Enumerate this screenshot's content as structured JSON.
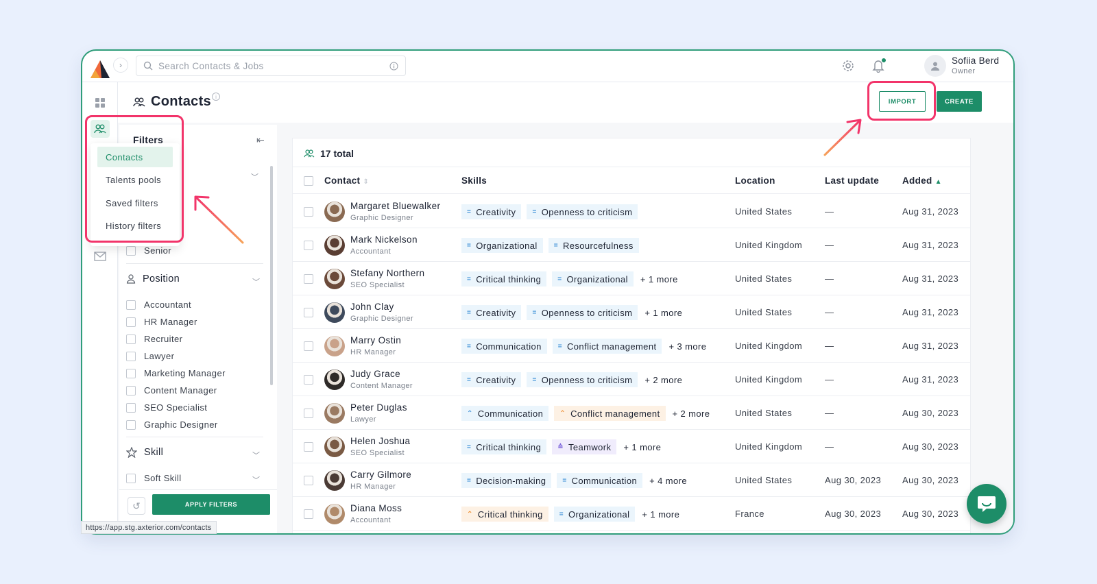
{
  "search": {
    "placeholder": "Search Contacts & Jobs"
  },
  "user": {
    "name": "Sofiia Berd",
    "role": "Owner"
  },
  "page": {
    "title": "Contacts",
    "import_label": "IMPORT",
    "create_label": "CREATE"
  },
  "menu": {
    "items": [
      "Contacts",
      "Talents pools",
      "Saved filters",
      "History filters"
    ]
  },
  "filters": {
    "title": "Filters",
    "senior_label": "Senior",
    "position": {
      "label": "Position",
      "options": [
        "Accountant",
        "HR Manager",
        "Recruiter",
        "Lawyer",
        "Marketing Manager",
        "Content Manager",
        "SEO Specialist",
        "Graphic Designer"
      ]
    },
    "skill": {
      "label": "Skill",
      "sub": "Soft Skill"
    },
    "apply_label": "APPLY FILTERS"
  },
  "table": {
    "total": "17 total",
    "headers": {
      "contact": "Contact",
      "skills": "Skills",
      "location": "Location",
      "last_update": "Last update",
      "added": "Added"
    },
    "rows": [
      {
        "name": "Margaret Bluewalker",
        "role": "Graphic Designer",
        "skills": [
          {
            "label": "Creativity",
            "icon": "="
          },
          {
            "label": "Openness to criticism",
            "icon": "="
          }
        ],
        "more": "",
        "location": "United States",
        "last_update": "—",
        "added": "Aug 31, 2023"
      },
      {
        "name": "Mark Nickelson",
        "role": "Accountant",
        "skills": [
          {
            "label": "Organizational",
            "icon": "="
          },
          {
            "label": "Resourcefulness",
            "icon": "="
          }
        ],
        "more": "",
        "location": "United Kingdom",
        "last_update": "—",
        "added": "Aug 31, 2023"
      },
      {
        "name": "Stefany Northern",
        "role": "SEO Specialist",
        "skills": [
          {
            "label": "Critical thinking",
            "icon": "="
          },
          {
            "label": "Organizational",
            "icon": "="
          }
        ],
        "more": "+ 1 more",
        "location": "United States",
        "last_update": "—",
        "added": "Aug 31, 2023"
      },
      {
        "name": "John Clay",
        "role": "Graphic Designer",
        "skills": [
          {
            "label": "Creativity",
            "icon": "="
          },
          {
            "label": "Openness to criticism",
            "icon": "="
          }
        ],
        "more": "+ 1 more",
        "location": "United States",
        "last_update": "—",
        "added": "Aug 31, 2023"
      },
      {
        "name": "Marry Ostin",
        "role": "HR Manager",
        "skills": [
          {
            "label": "Communication",
            "icon": "="
          },
          {
            "label": "Conflict management",
            "icon": "="
          }
        ],
        "more": "+ 3 more",
        "location": "United Kingdom",
        "last_update": "—",
        "added": "Aug 31, 2023"
      },
      {
        "name": "Judy Grace",
        "role": "Content Manager",
        "skills": [
          {
            "label": "Creativity",
            "icon": "="
          },
          {
            "label": "Openness to criticism",
            "icon": "="
          }
        ],
        "more": "+ 2 more",
        "location": "United Kingdom",
        "last_update": "—",
        "added": "Aug 31, 2023"
      },
      {
        "name": "Peter Duglas",
        "role": "Lawyer",
        "skills": [
          {
            "label": "Communication",
            "icon": "^",
            "tone": "plain"
          },
          {
            "label": "Conflict management",
            "icon": "^",
            "tone": "orange"
          }
        ],
        "more": "+ 2 more",
        "location": "United States",
        "last_update": "—",
        "added": "Aug 30, 2023"
      },
      {
        "name": "Helen Joshua",
        "role": "SEO Specialist",
        "skills": [
          {
            "label": "Critical thinking",
            "icon": "="
          },
          {
            "label": "Teamwork",
            "icon": "^",
            "tone": "purple"
          }
        ],
        "more": "+ 1 more",
        "location": "United Kingdom",
        "last_update": "—",
        "added": "Aug 30, 2023"
      },
      {
        "name": "Carry Gilmore",
        "role": "HR Manager",
        "skills": [
          {
            "label": "Decision-making",
            "icon": "="
          },
          {
            "label": "Communication",
            "icon": "="
          }
        ],
        "more": "+ 4 more",
        "location": "United States",
        "last_update": "Aug 30, 2023",
        "added": "Aug 30, 2023"
      },
      {
        "name": "Diana Moss",
        "role": "Accountant",
        "skills": [
          {
            "label": "Critical thinking",
            "icon": "^",
            "tone": "orange"
          },
          {
            "label": "Organizational",
            "icon": "="
          }
        ],
        "more": "+ 1 more",
        "location": "France",
        "last_update": "Aug 30, 2023",
        "added": "Aug 30, 2023"
      }
    ]
  },
  "status_url": "https://app.stg.axterior.com/contacts",
  "colors": {
    "accent": "#1d8d68",
    "highlight": "#f2346a",
    "skill_blue": "#ebf5fc",
    "skill_orange": "#fdf1e4",
    "skill_purple": "#f0ecfc"
  }
}
